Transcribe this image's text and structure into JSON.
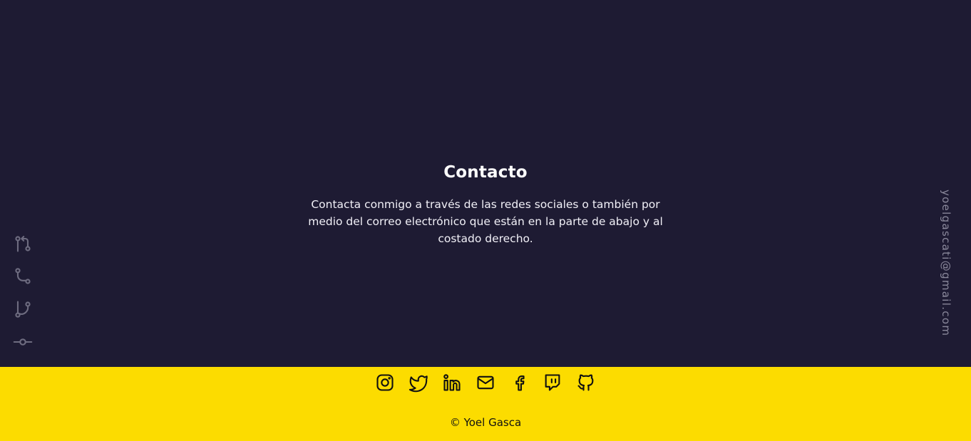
{
  "contact": {
    "title": "Contacto",
    "text": "Contacta conmigo a través de las redes sociales o también por medio del correo electrónico que están en la parte de abajo y al costado derecho."
  },
  "left_rail": {
    "icons": [
      "git-pull-request-icon",
      "git-merge-icon",
      "git-branch-icon",
      "git-commit-icon"
    ]
  },
  "right_rail": {
    "email": "yoelgascati@gmail.com"
  },
  "footer": {
    "social": [
      "instagram-icon",
      "twitter-icon",
      "linkedin-icon",
      "mail-icon",
      "facebook-icon",
      "twitch-icon",
      "github-icon"
    ],
    "copyright": "© Yoel Gasca"
  },
  "colors": {
    "background": "#1e1b33",
    "footer": "#fcdc00",
    "rail_icon": "#6e6c80",
    "email_text": "#8a889b"
  }
}
